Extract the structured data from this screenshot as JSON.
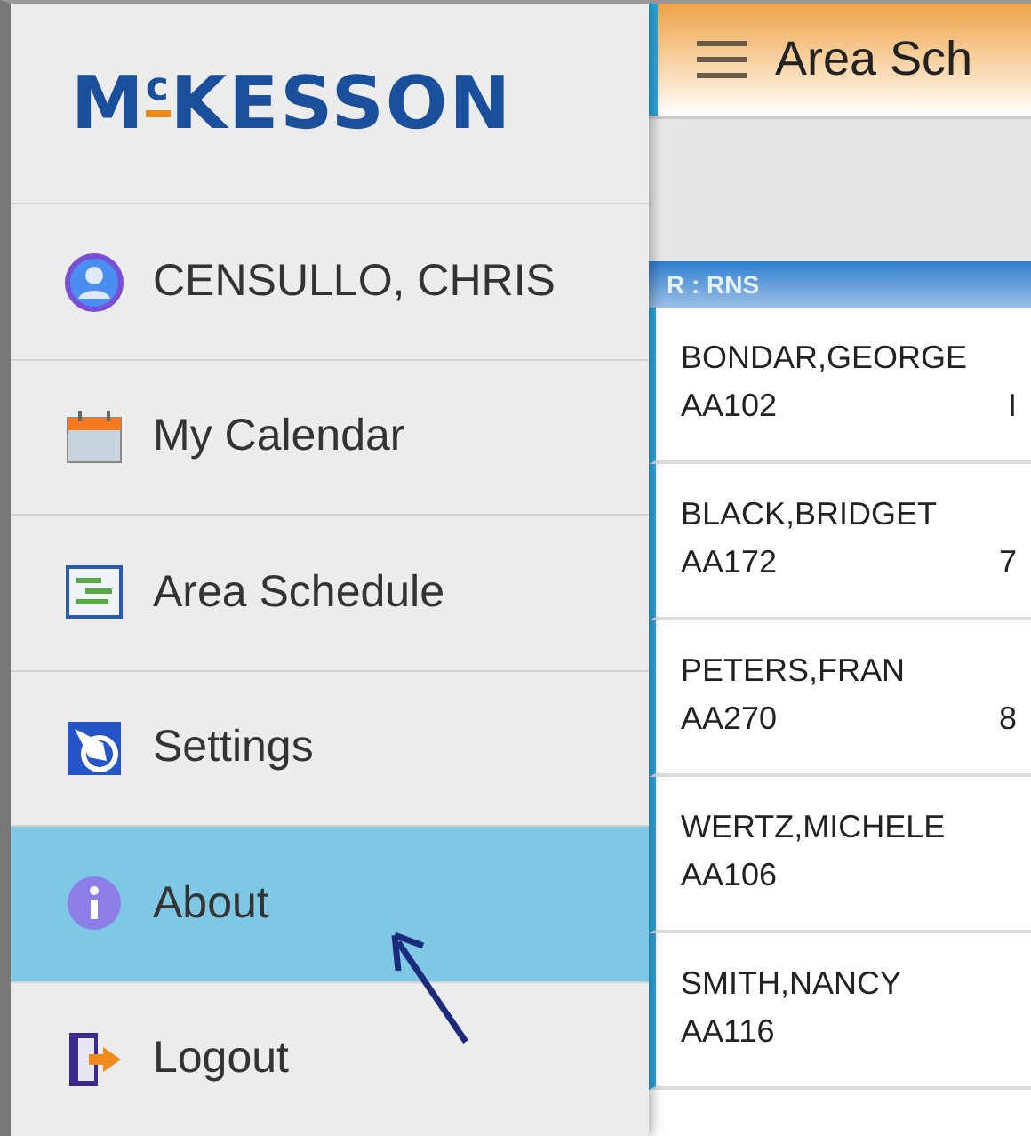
{
  "drawer": {
    "logo": "M$^{c}$KESSON",
    "items": [
      {
        "kind": "profile",
        "label": "CENSULLO, CHRIS",
        "selected": false
      },
      {
        "kind": "calendar",
        "label": "My Calendar",
        "selected": false
      },
      {
        "kind": "schedule",
        "label": "Area Schedule",
        "selected": false
      },
      {
        "kind": "settings",
        "label": "Settings",
        "selected": false
      },
      {
        "kind": "about",
        "label": "About",
        "selected": true
      },
      {
        "kind": "logout",
        "label": "Logout",
        "selected": false
      }
    ]
  },
  "app_bar": {
    "title": "Area Sch"
  },
  "group": {
    "label": "R : RNS"
  },
  "staff": [
    {
      "name": "BONDAR,GEORGE",
      "code": "AA102",
      "column_3": "I"
    },
    {
      "name": "BLACK,BRIDGET",
      "code": "AA172",
      "column_3": "7"
    },
    {
      "name": "PETERS,FRAN",
      "code": "AA270",
      "column_3": "8"
    },
    {
      "name": "WERTZ,MICHELE",
      "code": "AA106"
    },
    {
      "name": "SMITH,NANCY",
      "code": "AA116"
    }
  ]
}
